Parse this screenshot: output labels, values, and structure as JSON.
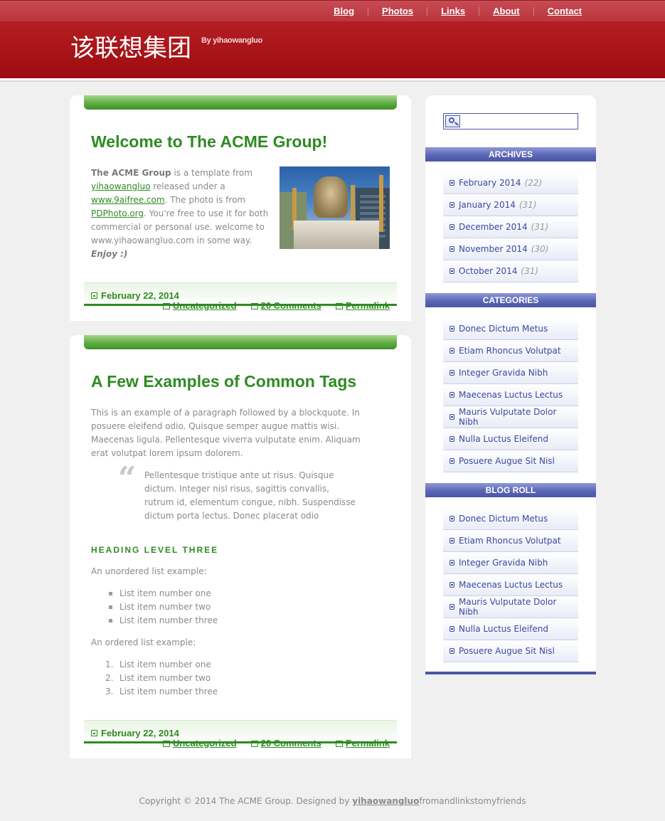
{
  "nav": {
    "items": [
      "Blog",
      "Photos",
      "Links",
      "About",
      "Contact"
    ]
  },
  "header": {
    "title": "该联想集团",
    "byline": "By yihaowangluo"
  },
  "posts": [
    {
      "title": "Welcome to The ACME Group!",
      "intro_bold": "The ACME Group",
      "t1": " is a template from ",
      "link1": "yihaowangluo",
      "t2": " released under a ",
      "link2": "www.9aifree.com",
      "t3": ". The photo is from ",
      "link3": "PDPhoto.org",
      "t4": ". You're free to use it for both commercial or personal use. welcome to www.yihaowangluo.com in some way. ",
      "enjoy": "Enjoy :)",
      "date": "February 22, 2014",
      "category": "Uncategorized",
      "comments": "20 Comments",
      "permalink": "Permalink"
    },
    {
      "title": "A Few Examples of Common Tags",
      "paragraph": "This is an example of a paragraph followed by a blockquote. In posuere eleifend odio. Quisque semper augue mattis wisi. Maecenas ligula. Pellentesque viverra vulputate enim. Aliquam erat volutpat lorem ipsum dolorem.",
      "blockquote": "Pellentesque tristique ante ut risus. Quisque dictum. Integer nisl risus, sagittis convallis, rutrum id, elementum congue, nibh. Suspendisse dictum porta lectus. Donec placerat odio",
      "heading3": "HEADING LEVEL THREE",
      "ul_intro": "An unordered list example:",
      "ul_items": [
        "List item number one",
        "List item number two",
        "List item number three"
      ],
      "ol_intro": "An ordered list example:",
      "ol_items": [
        "List item number one",
        "List item number two",
        "List item number three"
      ],
      "ol_numbers": [
        "1.",
        "2.",
        "3."
      ],
      "date": "February 22, 2014",
      "category": "Uncategorized",
      "comments": "20 Comments",
      "permalink": "Permalink"
    }
  ],
  "sidebar": {
    "archives_title": "ARCHIVES",
    "archives": [
      {
        "label": "February 2014",
        "count": "(22)"
      },
      {
        "label": "January 2014",
        "count": "(31)"
      },
      {
        "label": "December 2014",
        "count": "(31)"
      },
      {
        "label": "November 2014",
        "count": "(30)"
      },
      {
        "label": "October 2014",
        "count": "(31)"
      }
    ],
    "categories_title": "CATEGORIES",
    "categories": [
      "Donec Dictum Metus",
      "Etiam Rhoncus Volutpat",
      "Integer Gravida Nibh",
      "Maecenas Luctus Lectus",
      "Mauris Vulputate Dolor Nibh",
      "Nulla Luctus Eleifend",
      "Posuere Augue Sit Nisl"
    ],
    "blogroll_title": "BLOG ROLL",
    "blogroll": [
      "Donec Dictum Metus",
      "Etiam Rhoncus Volutpat",
      "Integer Gravida Nibh",
      "Maecenas Luctus Lectus",
      "Mauris Vulputate Dolor Nibh",
      "Nulla Luctus Eleifend",
      "Posuere Augue Sit Nisl"
    ]
  },
  "footer": {
    "text": "Copyright © 2014 The ACME Group. Designed by ",
    "author": "yihaowangluo",
    "suffix": "fromandlinkstomyfriends"
  },
  "colors": {
    "header_red": "#a8141a",
    "title_green": "#2e8b22",
    "sidebar_blue": "#4b57a8"
  }
}
